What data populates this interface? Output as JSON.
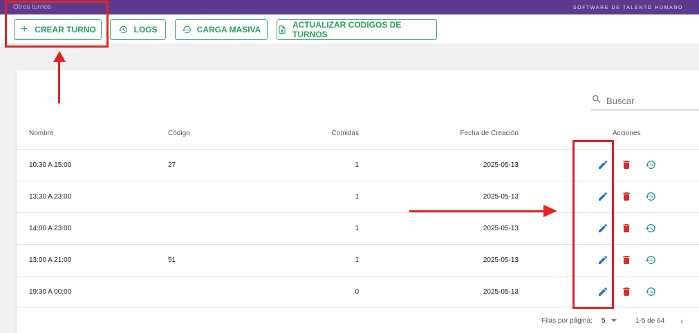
{
  "topbar": {
    "title": "Otros turnos",
    "brand": "SOFTWARE DE TALENTO HUMANO"
  },
  "toolbar": {
    "buttons": [
      {
        "label": "CREAR TURNO",
        "icon": "plus-icon"
      },
      {
        "label": "LOGS",
        "icon": "history-icon"
      },
      {
        "label": "CARGA MASIVA",
        "icon": "history-icon"
      },
      {
        "label": "ACTUALIZAR CODIGOS DE TURNOS",
        "icon": "file-upload-icon"
      }
    ]
  },
  "search": {
    "placeholder": "Buscar",
    "icon": "search-icon"
  },
  "table": {
    "headers": [
      "Nombre",
      "Código",
      "Comidas",
      "Fecha de Creación",
      "Acciones"
    ],
    "rows": [
      {
        "nombre": "10:30 A 15:00",
        "codigo": "27",
        "comidas": "1",
        "fecha": "2025-05-13"
      },
      {
        "nombre": "13:30 A 23:00",
        "codigo": "",
        "comidas": "1",
        "fecha": "2025-05-13"
      },
      {
        "nombre": "14:00 A 23:00",
        "codigo": "",
        "comidas": "1",
        "fecha": "2025-05-13"
      },
      {
        "nombre": "13:00 A 21:00",
        "codigo": "51",
        "comidas": "1",
        "fecha": "2025-05-13"
      },
      {
        "nombre": "19:30 A 00:00",
        "codigo": "",
        "comidas": "0",
        "fecha": "2025-05-13"
      }
    ],
    "action_icons": [
      "edit-icon",
      "delete-icon",
      "history-icon"
    ]
  },
  "pagination": {
    "rows_per_page_label": "Filas por página:",
    "rows_per_page": "5",
    "range": "1-5 de 64"
  },
  "colors": {
    "topbar": "#5e3a8f",
    "accent_green": "#27a05a",
    "edit_blue": "#1976d2",
    "delete_red": "#d32f2f",
    "history_teal": "#1a9a8a",
    "annotation_red": "#e02424"
  }
}
